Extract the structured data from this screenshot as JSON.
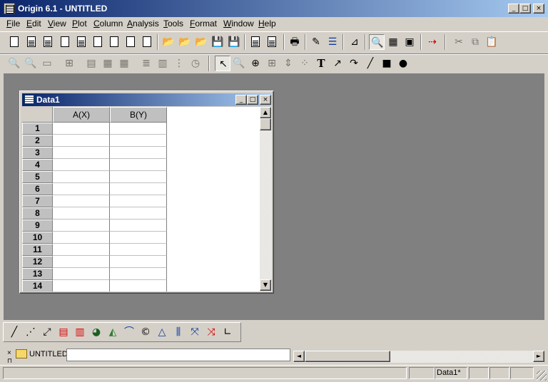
{
  "app": {
    "title": "Origin 6.1 - UNTITLED"
  },
  "window_controls": {
    "minimize": "_",
    "maximize": "□",
    "close": "×"
  },
  "menu": [
    {
      "label": "File",
      "underline": "F",
      "rest": "ile"
    },
    {
      "label": "Edit",
      "underline": "E",
      "rest": "dit"
    },
    {
      "label": "View",
      "underline": "V",
      "rest": "iew"
    },
    {
      "label": "Plot",
      "underline": "P",
      "rest": "lot"
    },
    {
      "label": "Column",
      "underline": "C",
      "rest": "olumn"
    },
    {
      "label": "Analysis",
      "underline": "A",
      "rest": "nalysis"
    },
    {
      "label": "Tools",
      "underline": "T",
      "rest": "ools"
    },
    {
      "label": "Format",
      "underline": "F",
      "rest": "ormat"
    },
    {
      "label": "Window",
      "underline": "W",
      "rest": "indow"
    },
    {
      "label": "Help",
      "underline": "H",
      "rest": "elp"
    }
  ],
  "toolbar2_text": {
    "text_tool": "T"
  },
  "worksheet": {
    "title": "Data1",
    "columns": [
      "A(X)",
      "B(Y)"
    ],
    "rows": [
      "1",
      "2",
      "3",
      "4",
      "5",
      "6",
      "7",
      "8",
      "9",
      "10",
      "11",
      "12",
      "13",
      "14"
    ]
  },
  "scroll": {
    "up": "▲",
    "down": "▼",
    "left": "◄",
    "right": "►"
  },
  "project": {
    "folder": "UNTITLED",
    "close": "×",
    "pin": "⊓"
  },
  "status": {
    "window_name": "Data1*"
  }
}
